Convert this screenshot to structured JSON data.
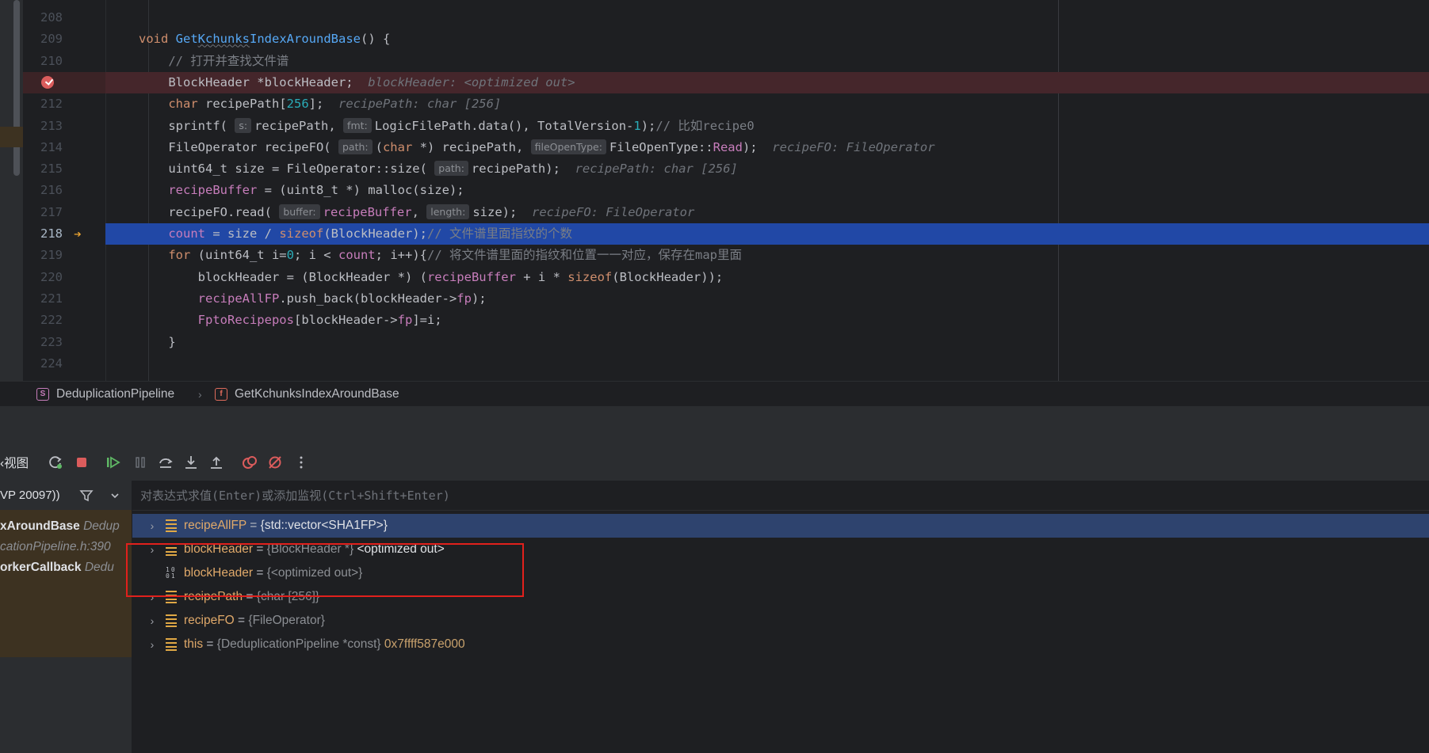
{
  "editor": {
    "lines": [
      {
        "num": "208",
        "tokens": []
      },
      {
        "num": "209",
        "tokens": [
          [
            "kw",
            "void "
          ],
          [
            "fn",
            "Get"
          ],
          [
            "fn squiggle",
            "Kchunks"
          ],
          [
            "fn",
            "IndexAroundBase"
          ],
          [
            "plain",
            "() {"
          ]
        ]
      },
      {
        "num": "210",
        "tokens": [
          [
            "cm",
            "    // 打开并查找文件谱"
          ]
        ]
      },
      {
        "num": "",
        "tokens": [
          [
            "plain",
            "    BlockHeader *blockHeader;"
          ],
          [
            "inlay",
            "  blockHeader: <optimized out>"
          ]
        ]
      },
      {
        "num": "212",
        "tokens": [
          [
            "plain",
            "    "
          ],
          [
            "kw",
            "char "
          ],
          [
            "plain",
            "recipePath["
          ],
          [
            "num",
            "256"
          ],
          [
            "plain",
            "];"
          ],
          [
            "inlay",
            "  recipePath: char [256]"
          ]
        ]
      },
      {
        "num": "213",
        "tokens": [
          [
            "plain",
            "    sprintf( "
          ],
          [
            "hint",
            "s:"
          ],
          [
            "plain",
            "recipePath, "
          ],
          [
            "hint",
            "fmt:"
          ],
          [
            "plain",
            "LogicFilePath.data(), TotalVersion-"
          ],
          [
            "num",
            "1"
          ],
          [
            "plain",
            ");"
          ],
          [
            "cm",
            "// 比如recipe0"
          ]
        ]
      },
      {
        "num": "214",
        "tokens": [
          [
            "plain",
            "    FileOperator recipeFO( "
          ],
          [
            "hint",
            "path:"
          ],
          [
            "plain",
            "("
          ],
          [
            "kw",
            "char "
          ],
          [
            "plain",
            "*) recipePath, "
          ],
          [
            "hint",
            "fileOpenType:"
          ],
          [
            "plain",
            "FileOpenType::"
          ],
          [
            "mem",
            "Read"
          ],
          [
            "plain",
            ");"
          ],
          [
            "inlay",
            "  recipeFO: FileOperator"
          ]
        ]
      },
      {
        "num": "215",
        "tokens": [
          [
            "plain",
            "    uint64_t size = FileOperator::size( "
          ],
          [
            "hint",
            "path:"
          ],
          [
            "plain",
            "recipePath);"
          ],
          [
            "inlay",
            "  recipePath: char [256]"
          ]
        ]
      },
      {
        "num": "216",
        "tokens": [
          [
            "plain",
            "    "
          ],
          [
            "mem",
            "recipeBuffer"
          ],
          [
            "plain",
            " = (uint8_t *) malloc(size);"
          ]
        ]
      },
      {
        "num": "217",
        "tokens": [
          [
            "plain",
            "    recipeFO.read( "
          ],
          [
            "hint",
            "buffer:"
          ],
          [
            "mem",
            "recipeBuffer"
          ],
          [
            "plain",
            ", "
          ],
          [
            "hint",
            "length:"
          ],
          [
            "plain",
            "size);"
          ],
          [
            "inlay",
            "  recipeFO: FileOperator"
          ]
        ]
      },
      {
        "num": "218",
        "tokens": [
          [
            "plain",
            "    "
          ],
          [
            "mem",
            "count"
          ],
          [
            "plain",
            " = size / "
          ],
          [
            "kw",
            "sizeof"
          ],
          [
            "plain",
            "(BlockHeader);"
          ],
          [
            "cm",
            "// 文件谱里面指纹的个数"
          ]
        ]
      },
      {
        "num": "219",
        "tokens": [
          [
            "plain",
            "    "
          ],
          [
            "kw",
            "for "
          ],
          [
            "plain",
            "(uint64_t i="
          ],
          [
            "num",
            "0"
          ],
          [
            "plain",
            "; i < "
          ],
          [
            "mem",
            "count"
          ],
          [
            "plain",
            "; i++){"
          ],
          [
            "cm",
            "// 将文件谱里面的指纹和位置一一对应，保存在map里面"
          ]
        ]
      },
      {
        "num": "220",
        "tokens": [
          [
            "plain",
            "        blockHeader = (BlockHeader *) ("
          ],
          [
            "mem",
            "recipeBuffer"
          ],
          [
            "plain",
            " + i * "
          ],
          [
            "kw",
            "sizeof"
          ],
          [
            "plain",
            "(BlockHeader));"
          ]
        ]
      },
      {
        "num": "221",
        "tokens": [
          [
            "plain",
            "        "
          ],
          [
            "mem",
            "recipeAllFP"
          ],
          [
            "plain",
            ".push_back(blockHeader->"
          ],
          [
            "mem",
            "fp"
          ],
          [
            "plain",
            ");"
          ]
        ]
      },
      {
        "num": "222",
        "tokens": [
          [
            "plain",
            "        "
          ],
          [
            "mem",
            "FptoRecipepos"
          ],
          [
            "plain",
            "[blockHeader->"
          ],
          [
            "mem",
            "fp"
          ],
          [
            "plain",
            "]=i;"
          ]
        ]
      },
      {
        "num": "223",
        "tokens": [
          [
            "plain",
            "    }"
          ]
        ]
      },
      {
        "num": "224",
        "tokens": []
      }
    ]
  },
  "breadcrumb": {
    "class_badge": "S",
    "class_name": "DeduplicationPipeline",
    "separator": "›",
    "func_badge": "f",
    "func_name": "GetKchunksIndexAroundBase"
  },
  "debug": {
    "view_title": "‹视图",
    "thread_label": "VP 20097))",
    "frames": [
      {
        "name": "xAroundBase",
        "loc": " Dedup"
      },
      {
        "name": "",
        "loc": "cationPipeline.h:390"
      },
      {
        "name": "orkerCallback",
        "loc": " Dedu"
      }
    ],
    "eval_placeholder": "对表达式求值(Enter)或添加监视(Ctrl+Shift+Enter)",
    "variables": [
      {
        "chev": "›",
        "icon": "stack",
        "name": "recipeAllFP",
        "eq": " = ",
        "type": "",
        "value": "{std::vector<SHA1FP>}",
        "addr": "",
        "selected": true
      },
      {
        "chev": "›",
        "icon": "stack",
        "name": "blockHeader",
        "eq": " = ",
        "type": "{BlockHeader *} ",
        "value": "<optimized out>",
        "addr": "",
        "selected": false
      },
      {
        "chev": "",
        "icon": "binary",
        "name": "blockHeader",
        "eq": " = ",
        "type": "{<optimized out>}",
        "value": "",
        "addr": "",
        "selected": false
      },
      {
        "chev": "›",
        "icon": "stack",
        "name": "recipePath",
        "eq": " = ",
        "type": "{char [256]}",
        "value": "",
        "addr": "",
        "selected": false
      },
      {
        "chev": "›",
        "icon": "stack",
        "name": "recipeFO",
        "eq": " = ",
        "type": "{FileOperator}",
        "value": "",
        "addr": "",
        "selected": false
      },
      {
        "chev": "›",
        "icon": "stack",
        "name": "this",
        "eq": " = ",
        "type": "{DeduplicationPipeline *const} ",
        "value": "",
        "addr": "0x7ffff587e000",
        "selected": false
      }
    ]
  },
  "colors": {
    "breakpoint": "#db5c5c",
    "execution_line": "#2148a6",
    "highlight_box": "#e1201c"
  },
  "icons": {
    "gutter_breakpoint": "breakpoint-icon",
    "gutter_exec": "execution-arrow-icon",
    "toolbar": [
      "rerun-icon",
      "stop-icon",
      "resume-icon",
      "pause-icon",
      "step-over-icon",
      "step-into-icon",
      "step-out-icon",
      "view-breakpoints-icon",
      "mute-breakpoints-icon",
      "more-icon"
    ],
    "filter": "filter-icon",
    "dropdown": "chevron-down-icon"
  }
}
